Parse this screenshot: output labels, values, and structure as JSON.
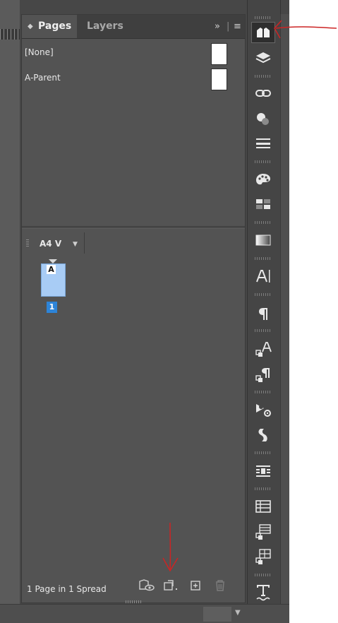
{
  "panel": {
    "tabs": [
      {
        "label": "Pages",
        "active": true
      },
      {
        "label": "Layers",
        "active": false
      }
    ],
    "parents": [
      {
        "name": "[None]"
      },
      {
        "name": "A-Parent"
      }
    ],
    "page_size": {
      "label": "A4 V"
    },
    "pages": [
      {
        "number": "1",
        "parent_letter": "A",
        "selected": true
      }
    ],
    "status": "1 Page in 1 Spread",
    "footer_icons": [
      "edit-page-size-icon",
      "new-page-icon",
      "delete-page-icon"
    ]
  },
  "side_strip": {
    "icons": [
      "pages-icon",
      "layers-icon",
      "links-icon",
      "color-icon",
      "stroke-icon",
      "swatches-icon",
      "table-swatches-icon",
      "gradient-icon",
      "character-icon",
      "paragraph-icon",
      "character-styles-icon",
      "paragraph-styles-icon",
      "effects-icon",
      "cc-libraries-icon",
      "text-wrap-icon",
      "table-icon",
      "table-styles-icon",
      "cell-styles-icon",
      "type-on-path-icon"
    ],
    "active": "pages-icon"
  },
  "colors": {
    "panel_bg": "#535353",
    "tab_bar_bg": "#3f3f3f",
    "page_thumb": "#a8ccf5",
    "page_number_badge": "#2d84d8",
    "annotation_red": "#cc2424"
  }
}
